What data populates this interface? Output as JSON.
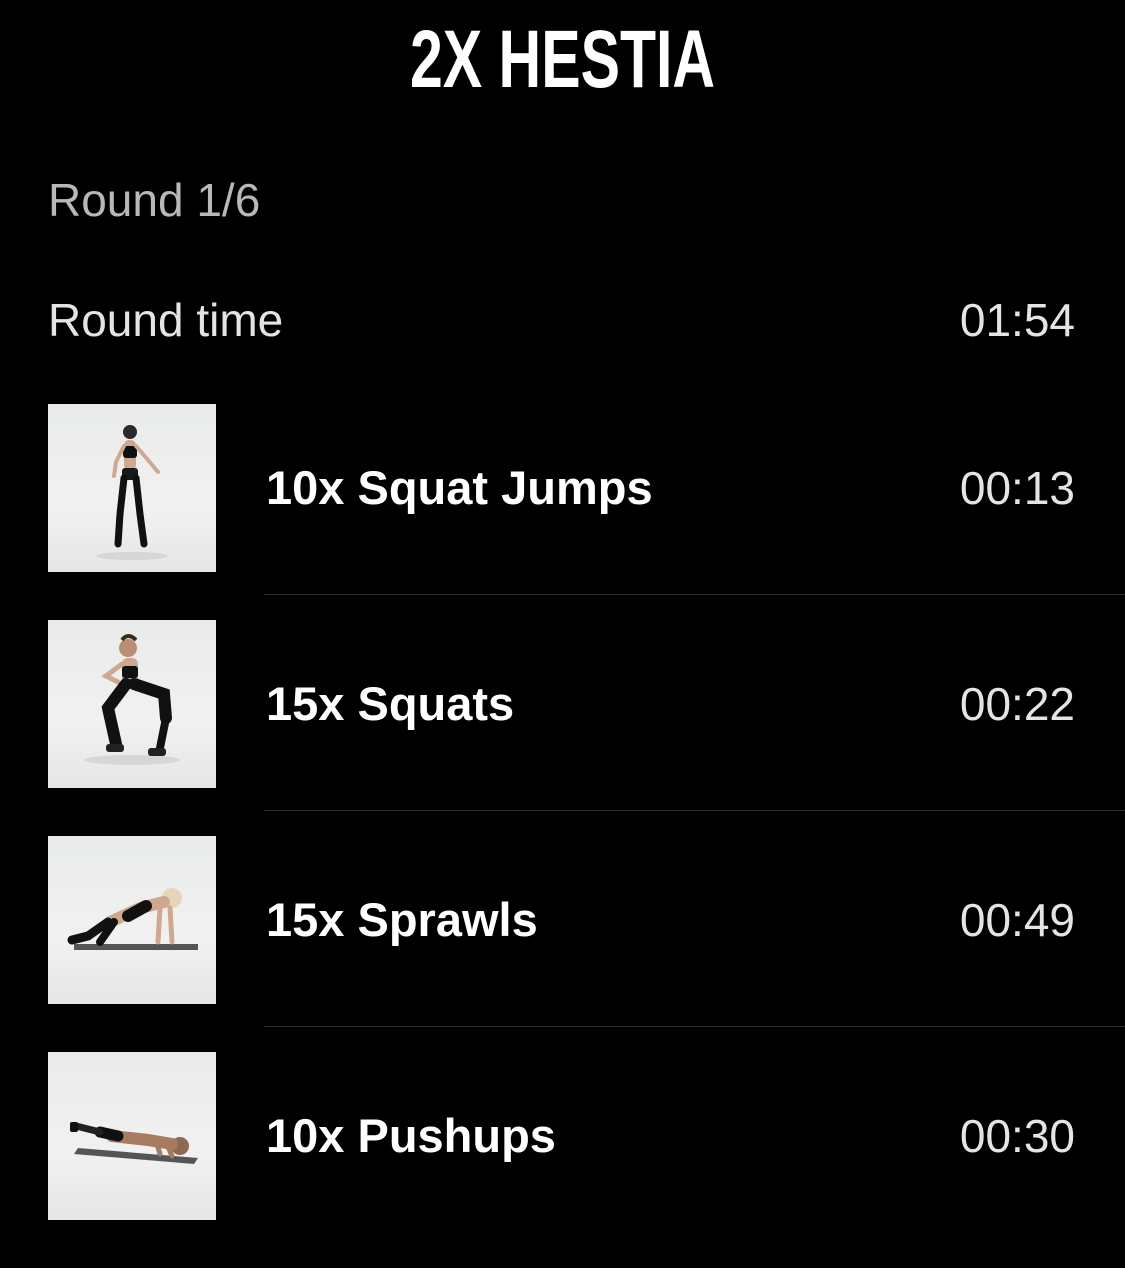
{
  "header": {
    "title": "2X HESTIA"
  },
  "round": {
    "label": "Round 1/6",
    "time_label": "Round time",
    "time_value": "01:54"
  },
  "exercises": [
    {
      "name": "10x Squat Jumps",
      "time": "00:13",
      "thumbnail_icon": "squat-jump-thumbnail"
    },
    {
      "name": "15x Squats",
      "time": "00:22",
      "thumbnail_icon": "squat-thumbnail"
    },
    {
      "name": "15x Sprawls",
      "time": "00:49",
      "thumbnail_icon": "sprawl-thumbnail"
    },
    {
      "name": "10x Pushups",
      "time": "00:30",
      "thumbnail_icon": "pushup-thumbnail"
    }
  ],
  "colors": {
    "background": "#000000",
    "primary_text": "#ffffff",
    "secondary_text": "#b8b8b8",
    "divider": "#2e2e2e"
  }
}
